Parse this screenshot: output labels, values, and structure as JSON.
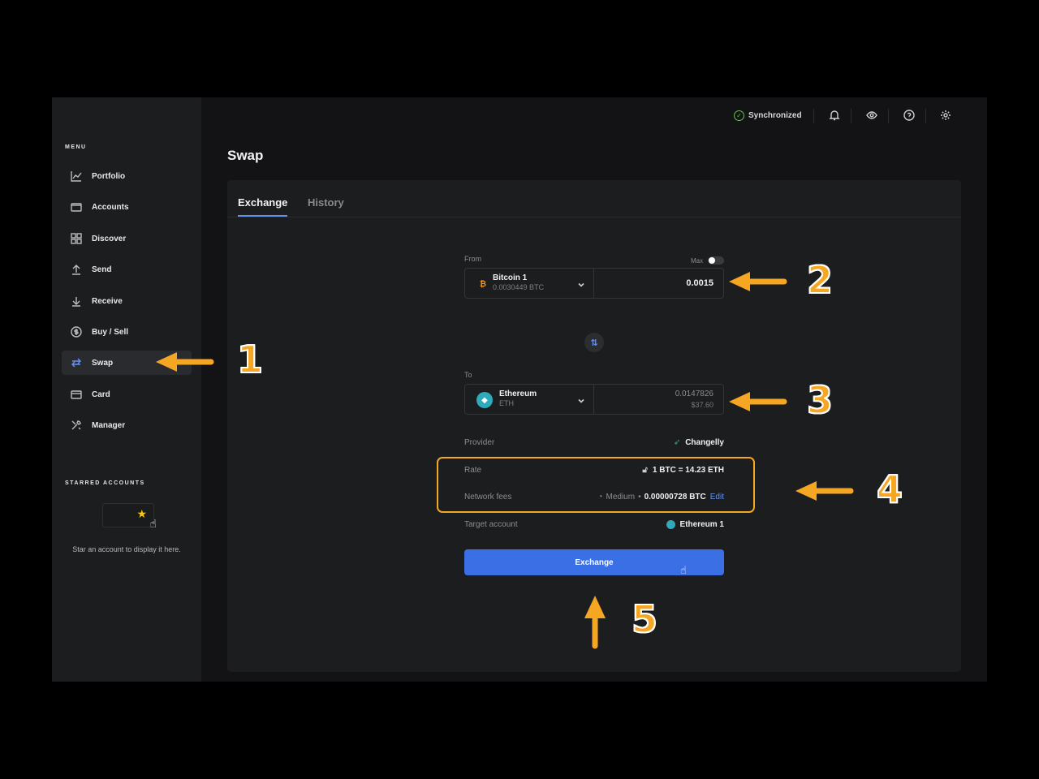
{
  "sidebar": {
    "menu_title": "MENU",
    "items": [
      {
        "label": "Portfolio",
        "icon": "chart-icon"
      },
      {
        "label": "Accounts",
        "icon": "wallet-icon"
      },
      {
        "label": "Discover",
        "icon": "grid-icon"
      },
      {
        "label": "Send",
        "icon": "arrow-up-icon"
      },
      {
        "label": "Receive",
        "icon": "arrow-down-icon"
      },
      {
        "label": "Buy / Sell",
        "icon": "dollar-icon"
      },
      {
        "label": "Swap",
        "icon": "swap-icon",
        "active": true
      },
      {
        "label": "Card",
        "icon": "card-icon"
      },
      {
        "label": "Manager",
        "icon": "tools-icon"
      }
    ],
    "starred_title": "STARRED ACCOUNTS",
    "starred_message": "Star an account to display it here."
  },
  "topbar": {
    "sync_status": "Synchronized",
    "icons": [
      "bell-icon",
      "eye-icon",
      "help-icon",
      "settings-icon"
    ]
  },
  "page": {
    "title": "Swap",
    "tabs": [
      {
        "label": "Exchange",
        "active": true
      },
      {
        "label": "History"
      }
    ]
  },
  "form": {
    "from_label": "From",
    "max_label": "Max",
    "from_account": "Bitcoin 1",
    "from_balance": "0.0030449 BTC",
    "from_amount": "0.0015",
    "to_label": "To",
    "to_account": "Ethereum",
    "to_ticker": "ETH",
    "to_amount": "0.0147826",
    "to_fiat": "$37.60",
    "provider_label": "Provider",
    "provider_value": "Changelly",
    "rate_label": "Rate",
    "rate_value": "1 BTC = 14.23 ETH",
    "fees_label": "Network fees",
    "fees_speed": "Medium",
    "fees_sep": "•",
    "fees_value": "0.00000728 BTC",
    "fees_edit": "Edit",
    "target_label": "Target account",
    "target_value": "Ethereum 1",
    "exchange_button": "Exchange"
  },
  "colors": {
    "accent": "#6490f1",
    "button": "#3a6fe6",
    "annotation": "#f5a623",
    "sync_green": "#66be54"
  },
  "annotations": [
    "1",
    "2",
    "3",
    "4",
    "5"
  ]
}
